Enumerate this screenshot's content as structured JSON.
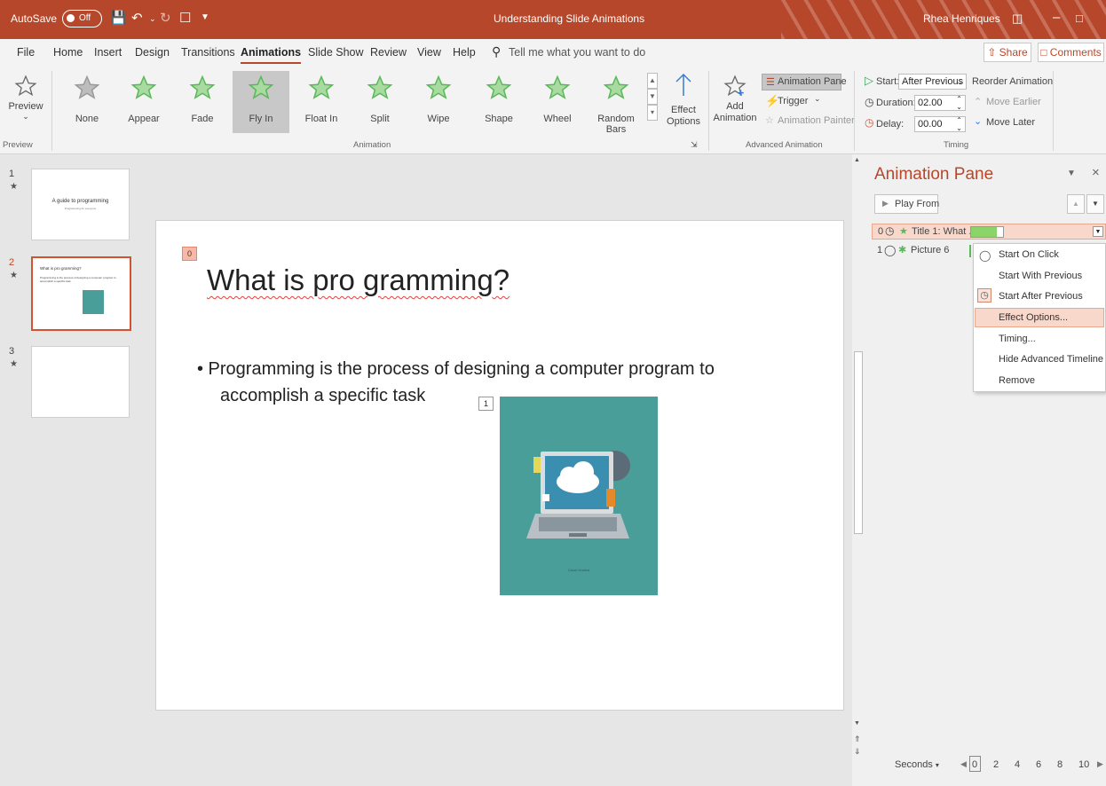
{
  "titlebar": {
    "autosave_label": "AutoSave",
    "autosave_state": "Off",
    "doc_title": "Understanding Slide Animations",
    "user_name": "Rhea Henriques"
  },
  "tabs": [
    "File",
    "Home",
    "Insert",
    "Design",
    "Transitions",
    "Animations",
    "Slide Show",
    "Review",
    "View",
    "Help"
  ],
  "active_tab": "Animations",
  "search_placeholder": "Tell me what you want to do",
  "share_label": "Share",
  "comments_label": "Comments",
  "ribbon": {
    "preview_label": "Preview",
    "preview_group": "Preview",
    "animations": [
      {
        "label": "None",
        "icon": "star-none-icon"
      },
      {
        "label": "Appear",
        "icon": "star-appear-icon"
      },
      {
        "label": "Fade",
        "icon": "star-fade-icon"
      },
      {
        "label": "Fly In",
        "icon": "star-flyin-icon"
      },
      {
        "label": "Float In",
        "icon": "star-floatin-icon"
      },
      {
        "label": "Split",
        "icon": "star-split-icon"
      },
      {
        "label": "Wipe",
        "icon": "star-wipe-icon"
      },
      {
        "label": "Shape",
        "icon": "star-shape-icon"
      },
      {
        "label": "Wheel",
        "icon": "star-wheel-icon"
      },
      {
        "label": "Random Bars",
        "icon": "star-randombars-icon"
      }
    ],
    "selected_animation": "Fly In",
    "effect_options_line1": "Effect",
    "effect_options_line2": "Options",
    "animation_group": "Animation",
    "add_animation_line1": "Add",
    "add_animation_line2": "Animation",
    "animation_pane_label": "Animation Pane",
    "trigger_label": "Trigger",
    "animation_painter_label": "Animation Painter",
    "advanced_group": "Advanced Animation",
    "start_label": "Start:",
    "start_value": "After Previous",
    "duration_label": "Duration:",
    "duration_value": "02.00",
    "delay_label": "Delay:",
    "delay_value": "00.00",
    "reorder_label": "Reorder Animation",
    "move_earlier_label": "Move Earlier",
    "move_later_label": "Move Later",
    "timing_group": "Timing"
  },
  "slides": [
    {
      "number": "1",
      "title": "A guide to programming",
      "subtitle": "Programming for everyone"
    },
    {
      "number": "2",
      "title": "What is pro gramming?",
      "bullet": "Programming is the process of designing a computer program to accomplish a specific task"
    },
    {
      "number": "3"
    }
  ],
  "current_slide": {
    "tag_title": "0",
    "title": "What is pro gramming?",
    "bullet_line1": "• Programming is the process of designing a computer program to",
    "bullet_line2": "accomplish a specific task",
    "tag_picture": "1",
    "picture_caption": "Cloud Hosted"
  },
  "pane": {
    "title": "Animation Pane",
    "play_from": "Play From",
    "items": [
      {
        "index": "0",
        "label": "Title 1: What ..."
      },
      {
        "index": "1",
        "label": "Picture 6"
      }
    ],
    "seconds_label": "Seconds",
    "timeline_ticks": [
      "0",
      "2",
      "4",
      "6",
      "8",
      "10"
    ]
  },
  "context_menu": [
    "Start On Click",
    "Start With Previous",
    "Start After Previous",
    "Effect Options...",
    "Timing...",
    "Hide Advanced Timeline",
    "Remove"
  ],
  "colors": {
    "accent": "#b7472a",
    "highlight": "#f9d8cc",
    "star_green": "#5ab85a"
  }
}
